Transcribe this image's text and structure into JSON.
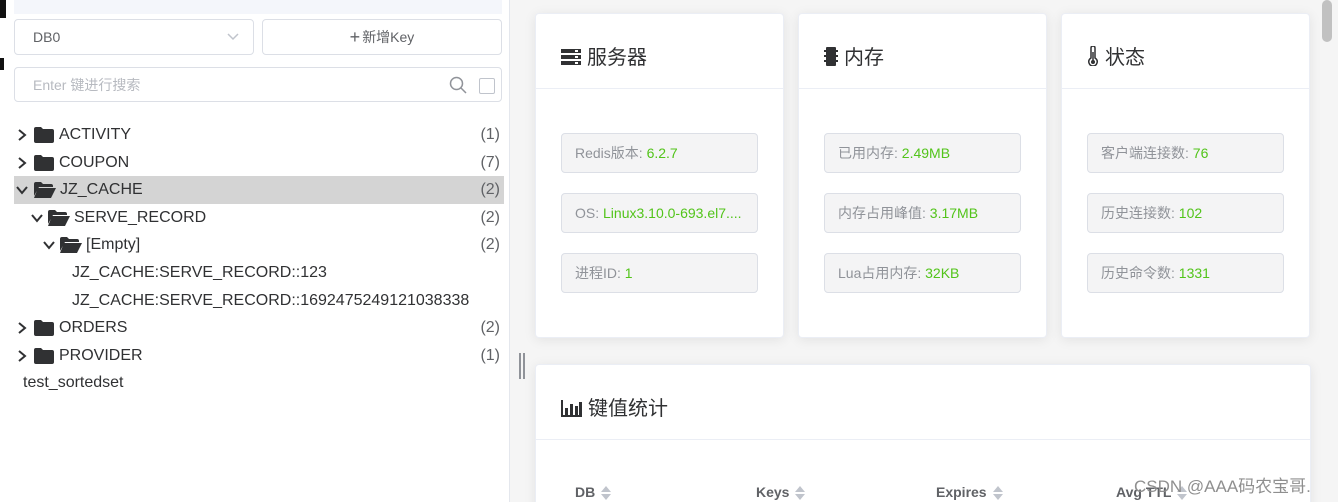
{
  "left_panel": {
    "db_select": {
      "value": "DB0"
    },
    "add_key_button": {
      "label": "新增Key"
    },
    "search": {
      "placeholder": "Enter 键进行搜索"
    },
    "tree": [
      {
        "label": "ACTIVITY",
        "count": "(1)"
      },
      {
        "label": "COUPON",
        "count": "(7)"
      },
      {
        "label": "JZ_CACHE",
        "count": "(2)"
      },
      {
        "label": "SERVE_RECORD",
        "count": "(2)"
      },
      {
        "label": "[Empty]",
        "count": "(2)"
      },
      {
        "label": "JZ_CACHE:SERVE_RECORD::123"
      },
      {
        "label": "JZ_CACHE:SERVE_RECORD::1692475249121038338"
      },
      {
        "label": "ORDERS",
        "count": "(2)"
      },
      {
        "label": "PROVIDER",
        "count": "(1)"
      },
      {
        "label": "test_sortedset"
      }
    ]
  },
  "cards": {
    "server": {
      "title": "服务器",
      "items": [
        {
          "label": "Redis版本: ",
          "value": "6.2.7"
        },
        {
          "label": "OS: ",
          "value": "Linux3.10.0-693.el7...."
        },
        {
          "label": "进程ID: ",
          "value": "1"
        }
      ]
    },
    "memory": {
      "title": "内存",
      "items": [
        {
          "label": "已用内存: ",
          "value": "2.49MB"
        },
        {
          "label": "内存占用峰值: ",
          "value": "3.17MB"
        },
        {
          "label": "Lua占用内存: ",
          "value": "32KB"
        }
      ]
    },
    "status": {
      "title": "状态",
      "items": [
        {
          "label": "客户端连接数: ",
          "value": "76"
        },
        {
          "label": "历史连接数: ",
          "value": "102"
        },
        {
          "label": "历史命令数: ",
          "value": "1331"
        }
      ]
    }
  },
  "key_stats": {
    "title": "键值统计",
    "columns": [
      "DB",
      "Keys",
      "Expires",
      "Avg TTL"
    ]
  },
  "watermark": "CSDN @AAA码农宝哥.",
  "colors": {
    "accent_value": "#52c41a",
    "selected_row": "#d4d4d4",
    "panel_bg": "#f5f5f5"
  }
}
